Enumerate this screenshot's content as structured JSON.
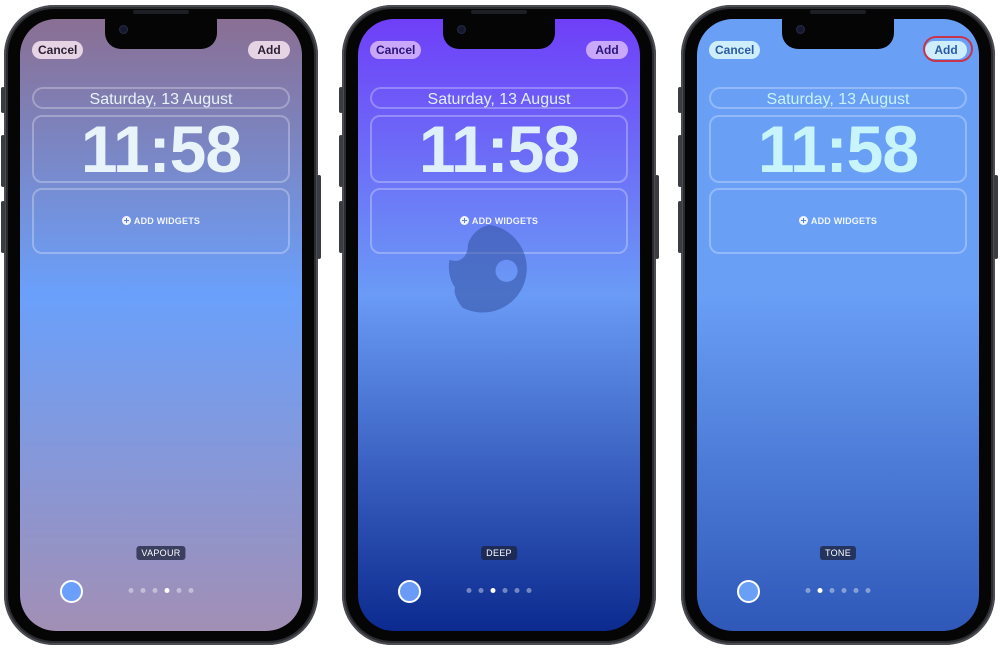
{
  "phones": [
    {
      "style_name": "VAPOUR",
      "buttons": {
        "cancel": "Cancel",
        "add": "Add"
      },
      "date": "Saturday, 13 August",
      "time": "11:58",
      "widgets_label": "ADD WIDGETS",
      "page_dots": {
        "count": 6,
        "active_index": 3
      },
      "colors": {
        "gradient_top": "#8a6f93",
        "gradient_mid": "#6aa0fb",
        "gradient_bottom": "#a28fb5",
        "button_bg": "#e6d4e4",
        "button_text": "#2a1f33",
        "text": "#e8f4fa",
        "swatch": "#6aa0fb"
      },
      "add_highlighted": false
    },
    {
      "style_name": "DEEP",
      "buttons": {
        "cancel": "Cancel",
        "add": "Add"
      },
      "date": "Saturday, 13 August",
      "time": "11:58",
      "widgets_label": "ADD WIDGETS",
      "page_dots": {
        "count": 6,
        "active_index": 2
      },
      "colors": {
        "gradient_top": "#6f3ff8",
        "gradient_mid": "#6a9bf6",
        "gradient_bottom": "#0c2a8f",
        "button_bg": "#c9a8fb",
        "button_text": "#2a137a",
        "text": "#dff0fb",
        "swatch": "#6a9bf6"
      },
      "add_highlighted": false,
      "watermark": "logo-watermark"
    },
    {
      "style_name": "TONE",
      "buttons": {
        "cancel": "Cancel",
        "add": "Add"
      },
      "date": "Saturday, 13 August",
      "time": "11:58",
      "widgets_label": "ADD WIDGETS",
      "page_dots": {
        "count": 6,
        "active_index": 1
      },
      "colors": {
        "gradient_top": "#6a9ff6",
        "gradient_mid": "#6a9ff6",
        "gradient_bottom": "#2f58b8",
        "button_bg": "#cdeefa",
        "button_text": "#2a5aa8",
        "text": "#c8f4fc",
        "swatch": "#6a9ff6"
      },
      "add_highlighted": true,
      "highlight_color": "#c8344a"
    }
  ]
}
